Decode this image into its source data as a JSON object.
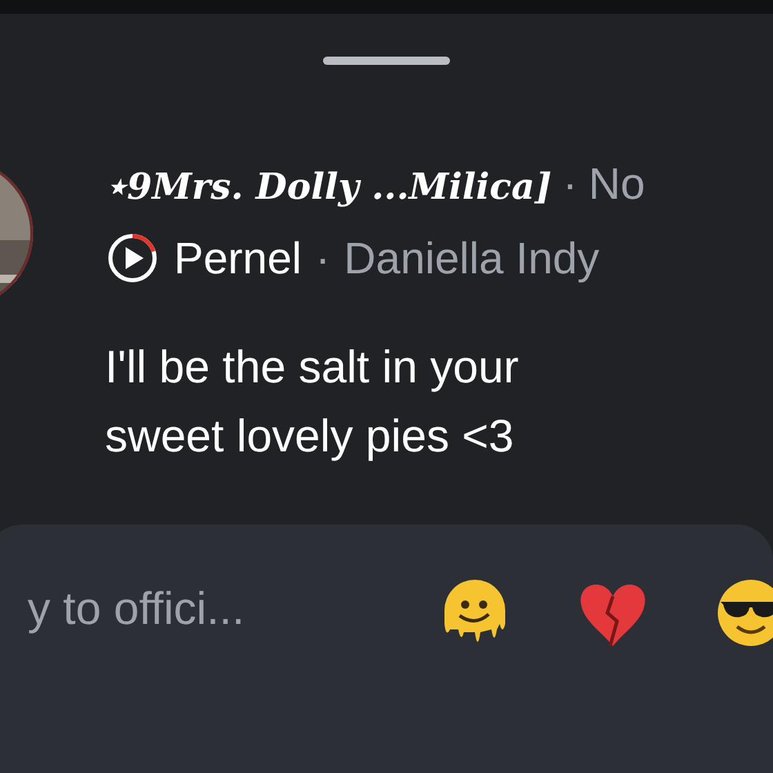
{
  "comment": {
    "author": "⋆9Mrs. Dolly ...Milica]",
    "separator": "·",
    "time": "No",
    "audio": {
      "level": 0.2,
      "title": "Pernel",
      "separator": "·",
      "artist": "Daniella Indy"
    },
    "text": "I'll be the salt in your sweet lovely pies <3"
  },
  "reply": {
    "placeholder": "y to offici...",
    "reactions": [
      {
        "kind": "melting"
      },
      {
        "kind": "broken-heart"
      },
      {
        "kind": "sunglasses"
      }
    ]
  }
}
